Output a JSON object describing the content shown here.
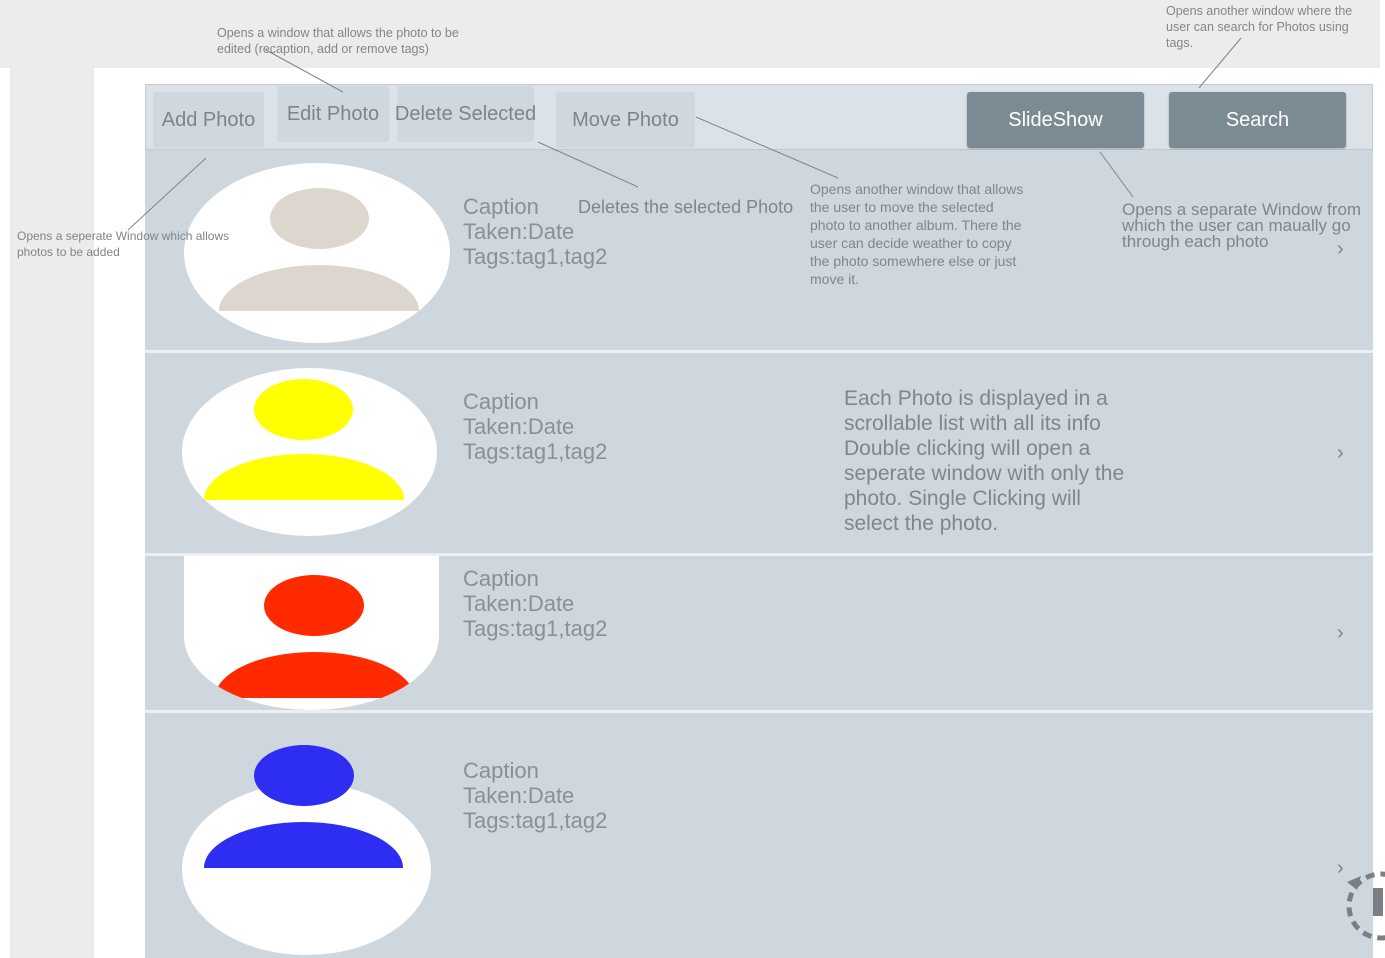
{
  "toolbar": {
    "add_photo": "Add Photo",
    "edit_photo": "Edit Photo",
    "delete_selected": "Delete Selected",
    "move_photo": "Move Photo",
    "slideshow": "SlideShow",
    "search": "Search"
  },
  "photos": [
    {
      "caption": "Caption",
      "taken": "Taken:Date",
      "tags": "Tags:tag1,tag2",
      "color": "#dcd6cf"
    },
    {
      "caption": "Caption",
      "taken": "Taken:Date",
      "tags": "Tags:tag1,tag2",
      "color": "#ffff00"
    },
    {
      "caption": "Caption",
      "taken": "Taken:Date",
      "tags": "Tags:tag1,tag2",
      "color": "#ff2a00"
    },
    {
      "caption": "Caption",
      "taken": "Taken:Date",
      "tags": "Tags:tag1,tag2",
      "color": "#2e2ef2"
    }
  ],
  "chevron": "›",
  "annotations": {
    "edit_note": [
      "Opens a window that allows the photo to be",
      "edited (recaption, add or remove tags)"
    ],
    "search_note": [
      "Opens another window where the",
      "user can search for Photos using",
      "tags."
    ],
    "add_note": [
      "Opens a seperate Window which allows",
      "photos to be added"
    ],
    "delete_note": "Deletes the selected Photo",
    "move_note": [
      "Opens another window that allows",
      "the user to move the selected",
      "photo to another album. There the",
      "user can decide weather to copy",
      "the photo somewhere else or just",
      "move it."
    ],
    "slideshow_note": [
      "Opens a separate Window from",
      "which the user can maually go",
      "through each photo"
    ],
    "list_note": [
      "Each Photo is displayed in a",
      "scrollable list with all its info",
      "Double clicking will open a",
      "seperate window with only the",
      "photo. Single Clicking will",
      "select the photo."
    ]
  }
}
